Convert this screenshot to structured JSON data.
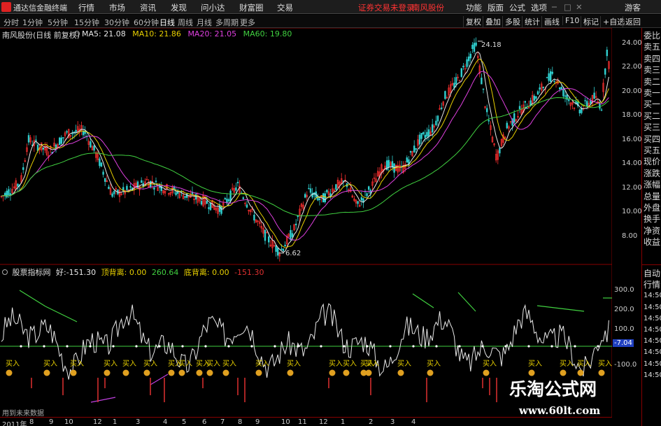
{
  "app": {
    "title": "通达信金融终端",
    "status_trade": "证券交易未登录",
    "stock_name_top": "南风股份"
  },
  "menus": [
    "行情",
    "市场",
    "资讯",
    "发现",
    "问小达",
    "财富圈",
    "交易"
  ],
  "menu_right": [
    "功能",
    "版面",
    "公式",
    "选项",
    "画线",
    "标记",
    "游客"
  ],
  "toolbar": {
    "periods": [
      "分时",
      "1分钟",
      "5分钟",
      "15分钟",
      "30分钟",
      "60分钟",
      "日线",
      "周线",
      "月线",
      "多周期",
      "更多"
    ],
    "active": "日线",
    "right": [
      "复权",
      "叠加",
      "多股",
      "统计",
      "画线",
      "F10",
      "标记",
      "+自选",
      "返回"
    ]
  },
  "main": {
    "title": "南风股份(日线 前复权)",
    "ma": [
      {
        "label": "MA5: 21.08",
        "color": "#e8e8e8"
      },
      {
        "label": "MA10: 21.86",
        "color": "#e8d000"
      },
      {
        "label": "MA20: 21.05",
        "color": "#e040e0"
      },
      {
        "label": "MA60: 19.80",
        "color": "#40d040"
      }
    ],
    "high_label": "24.18",
    "low_label": "6.62",
    "price_axis": [
      "24.00",
      "22.00",
      "20.00",
      "18.00",
      "16.00",
      "14.00",
      "12.00",
      "10.00",
      "8.00"
    ]
  },
  "indicator": {
    "title": "股票指标网",
    "values": [
      {
        "label": "好:-151.30",
        "color": "#e8e8e8"
      },
      {
        "label": "顶背离: 0.00",
        "color": "#e8d000"
      },
      {
        "label": "260.64",
        "color": "#40d040"
      },
      {
        "label": "底背离: 0.00",
        "color": "#e8d000"
      },
      {
        "label": "-151.30",
        "color": "#e03030"
      }
    ],
    "axis": [
      "300.0",
      "200.0",
      "100.0",
      "-100.0"
    ],
    "current_value": "-7.04",
    "buy_label": "买入",
    "footer": "用到未来数据"
  },
  "time_axis": [
    "2011年",
    "8",
    "9",
    "10",
    "12",
    "1",
    "3",
    "4",
    "5",
    "6",
    "7",
    "8",
    "9",
    "10",
    "11",
    "12",
    "1",
    "2",
    "3",
    "4"
  ],
  "right_panel": [
    "委比",
    "卖五",
    "卖四",
    "卖三",
    "卖二",
    "卖一",
    "买一",
    "买二",
    "买三",
    "买四",
    "买五",
    "现价",
    "涨跌",
    "涨幅",
    "总量",
    "外盘",
    "换手",
    "净资",
    "收益"
  ],
  "right_panel_lower": [
    "自动",
    "行情",
    "14:50",
    "14:50",
    "14:50",
    "14:50",
    "14:50",
    "14:50",
    "14:50",
    "14:50"
  ],
  "watermark": {
    "line1": "乐淘公式网",
    "line2": "www.60lt.com"
  },
  "colors": {
    "up": "#ff3030",
    "down": "#30d0d0",
    "ma5": "#e8e8e8",
    "ma10": "#e8d000",
    "ma20": "#e040e0",
    "ma60": "#40d040"
  }
}
